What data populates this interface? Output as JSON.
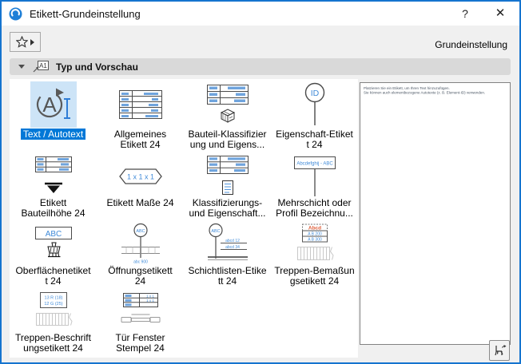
{
  "window": {
    "title": "Etikett-Grundeinstellung",
    "help": "?",
    "close": "✕"
  },
  "toolbar": {
    "right_label": "Grundeinstellung"
  },
  "section": {
    "title": "Typ und Vorschau",
    "icon_label": "A1"
  },
  "grid": {
    "items": [
      {
        "label": "Text / Autotext",
        "selected": true
      },
      {
        "label": "Allgemeines\nEtikett 24"
      },
      {
        "label": "Bauteil-Klassifizier\nung und Eigens..."
      },
      {
        "label": "Eigenschaft-Etiket\nt 24",
        "icon_text": "ID"
      },
      {
        "label": "Etikett\nBauteilhöhe 24"
      },
      {
        "label": "Etikett Maße 24",
        "icon_text": "1 x 1 x 1"
      },
      {
        "label": "Klassifizierungs-\nund Eigenschaft..."
      },
      {
        "label": "Mehrschicht oder\nProfil Bezeichnu...",
        "icon_text": "Abcdefghij - ABC"
      },
      {
        "label": "Oberflächenetiket\nt 24",
        "icon_text": "ABC"
      },
      {
        "label": "Öffnungsetikett\n24",
        "icon_text": "ABC",
        "icon_dim": "abc 900"
      },
      {
        "label": "Schichtlisten-Etike\ntt 24",
        "icon_text": "ABC",
        "icon_row1": "abcd 12",
        "icon_row2": "abcd 34"
      },
      {
        "label": "Treppen-Bemaßun\ngsetikett 24",
        "icon_header": "Abcd",
        "icon_row1": "A B   200",
        "icon_row2": "A B   300"
      },
      {
        "label": "Treppen-Beschrift\nungsetikett 24",
        "icon_row1": "13 R (18)",
        "icon_row2": "12 G (25)"
      },
      {
        "label": "Tür Fenster\nStempel 24",
        "icon_row1": "1 x 1",
        "icon_row2": "1 x 1"
      }
    ]
  },
  "preview": {
    "line1": "Platzieren Sie ein Etikett, um Ihren Text hinzuzufügen.",
    "line2": "Sie können auch elementbezogene Autotexte (z. B. Element-ID) verwenden."
  },
  "colors": {
    "accent": "#0078d7",
    "selection_fill": "#cde4f7",
    "window_border": "#1574cf"
  }
}
